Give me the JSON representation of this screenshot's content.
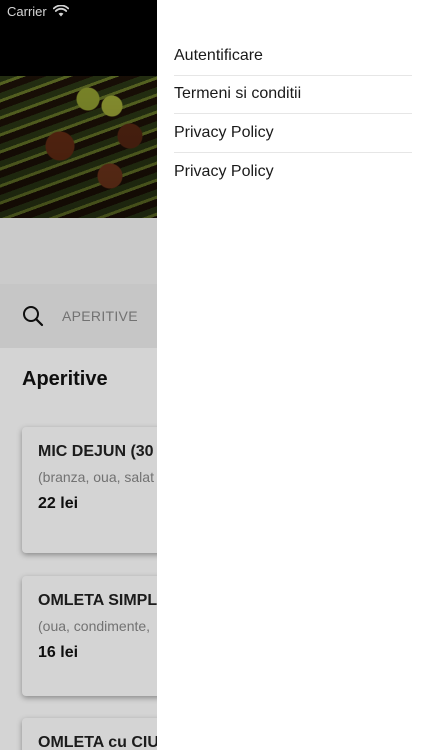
{
  "status_bar": {
    "carrier": "Carrier"
  },
  "search": {
    "placeholder": "APERITIVE"
  },
  "section": {
    "title": "Aperitive"
  },
  "menu_cards": [
    {
      "name": "MIC DEJUN (30",
      "description": "(branza, oua, salat rosii)",
      "price": "22 lei"
    },
    {
      "name": "OMLETA SIMPL",
      "description": "(oua, condimente,",
      "price": "16 lei"
    },
    {
      "name": "OMLETA cu CIU",
      "description": "",
      "price": ""
    }
  ],
  "drawer": {
    "items": [
      {
        "label": "Autentificare"
      },
      {
        "label": "Termeni si conditii"
      },
      {
        "label": "Privacy Policy"
      },
      {
        "label": "Privacy Policy"
      }
    ]
  }
}
